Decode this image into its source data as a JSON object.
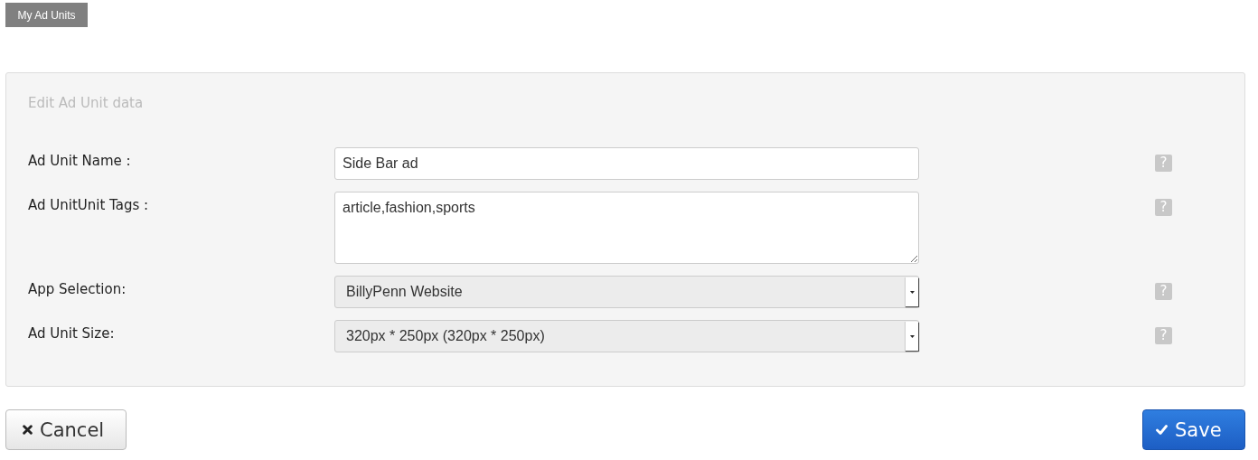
{
  "top_button": "My Ad Units",
  "panel": {
    "title": "Edit Ad Unit data",
    "fields": [
      {
        "kind": "text",
        "label": "Ad Unit Name :",
        "value": "Side Bar ad",
        "help": "?"
      },
      {
        "kind": "textarea",
        "label": "Ad UnitUnit Tags :",
        "value": "article,fashion,sports",
        "help": "?"
      },
      {
        "kind": "select",
        "label": "App Selection:",
        "value": "BillyPenn Website",
        "help": "?"
      },
      {
        "kind": "select",
        "label": "Ad Unit Size:",
        "value": "320px * 250px (320px * 250px)",
        "help": "?"
      }
    ]
  },
  "buttons": [
    {
      "kind": "cancel",
      "label": "Cancel"
    },
    {
      "kind": "save",
      "label": "Save"
    }
  ]
}
